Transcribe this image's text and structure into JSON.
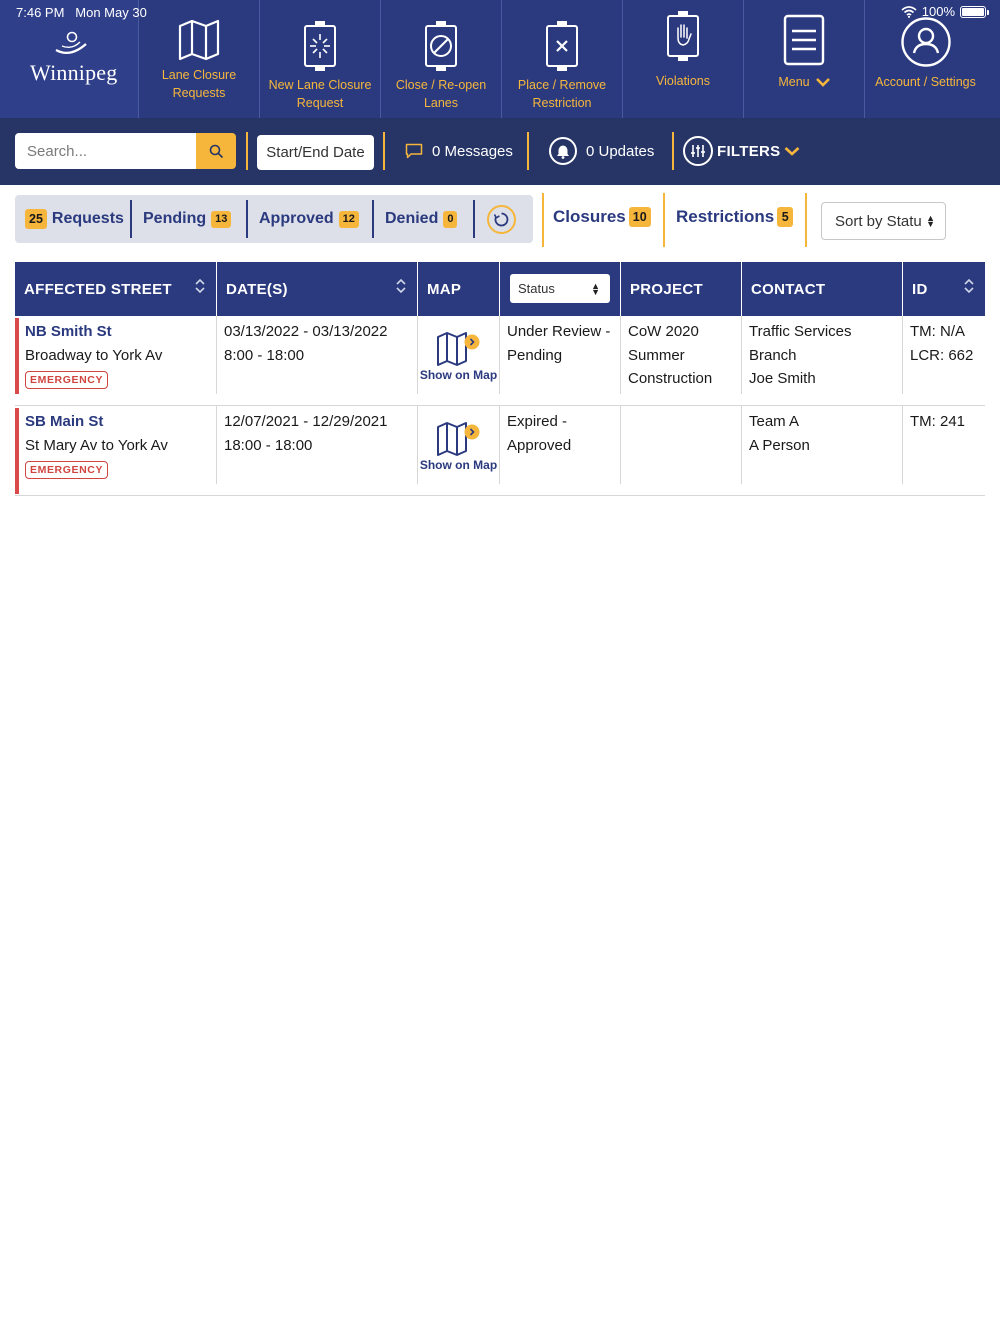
{
  "status_bar": {
    "time": "7:46 PM",
    "date": "Mon May 30",
    "battery": "100%"
  },
  "logo": {
    "wordmark": "Winnipeg"
  },
  "nav": [
    {
      "label_line1": "Lane Closure",
      "label_line2": "Requests",
      "icon": "map-icon"
    },
    {
      "label_line1": "New Lane Closure",
      "label_line2": "Request",
      "icon": "sign-burst-icon"
    },
    {
      "label_line1": "Close / Re-open",
      "label_line2": "Lanes",
      "icon": "sign-no-entry-icon"
    },
    {
      "label_line1": "Place / Remove",
      "label_line2": "Restriction",
      "icon": "sign-x-icon"
    },
    {
      "label_line1": "Violations",
      "label_line2": "",
      "icon": "sign-hand-icon"
    },
    {
      "label_line1": "Menu",
      "label_line2": "",
      "icon": "menu-list-icon"
    },
    {
      "label_line1": "Account / Settings",
      "label_line2": "",
      "icon": "user-icon"
    }
  ],
  "toolbar": {
    "search_placeholder": "Search...",
    "date_button": "Start/End Date",
    "messages": "0 Messages",
    "updates": "0 Updates",
    "filters": "FILTERS"
  },
  "tabs": [
    {
      "count": "25",
      "label": "Requests"
    },
    {
      "label": "Pending",
      "count": "13"
    },
    {
      "label": "Approved",
      "count": "12"
    },
    {
      "label": "Denied",
      "count": "0"
    }
  ],
  "view_tabs": [
    {
      "label": "Closures",
      "count": "10"
    },
    {
      "label": "Restrictions",
      "count": "5"
    }
  ],
  "sort_select": "Sort by Statu",
  "table": {
    "headers": [
      "AFFECTED STREET",
      "DATE(S)",
      "MAP",
      "PROJECT",
      "CONTACT",
      "ID"
    ],
    "status_filter": "Status",
    "rows": [
      {
        "street": "NB Smith St",
        "segment": "Broadway to York Av",
        "tag": "EMERGENCY",
        "dates": "03/13/2022 - 03/13/2022",
        "times": "8:00 - 18:00",
        "map_label": "Show on Map",
        "status_line1": "Under Review -",
        "status_line2": "Pending",
        "project_line1": "CoW 2020",
        "project_line2": "Summer",
        "project_line3": "Construction",
        "contact_line1": "Traffic Services Branch",
        "contact_line2": "Joe Smith",
        "id_line1": "TM: N/A",
        "id_line2": "LCR: 662"
      },
      {
        "street": "SB Main St",
        "segment": "St Mary Av to York Av",
        "tag": "EMERGENCY",
        "dates": "12/07/2021 - 12/29/2021",
        "times": "18:00 - 18:00",
        "map_label": "Show on Map",
        "status_line1": "Expired -",
        "status_line2": "Approved",
        "project_line1": "",
        "project_line2": "",
        "project_line3": "",
        "contact_line1": "Team A",
        "contact_line2": "A Person",
        "id_line1": "TM: 241",
        "id_line2": ""
      }
    ]
  },
  "colors": {
    "navy": "#2b3a7f",
    "toolbar": "#263466",
    "accent": "#f6b63b",
    "emergency": "#d0463f"
  }
}
